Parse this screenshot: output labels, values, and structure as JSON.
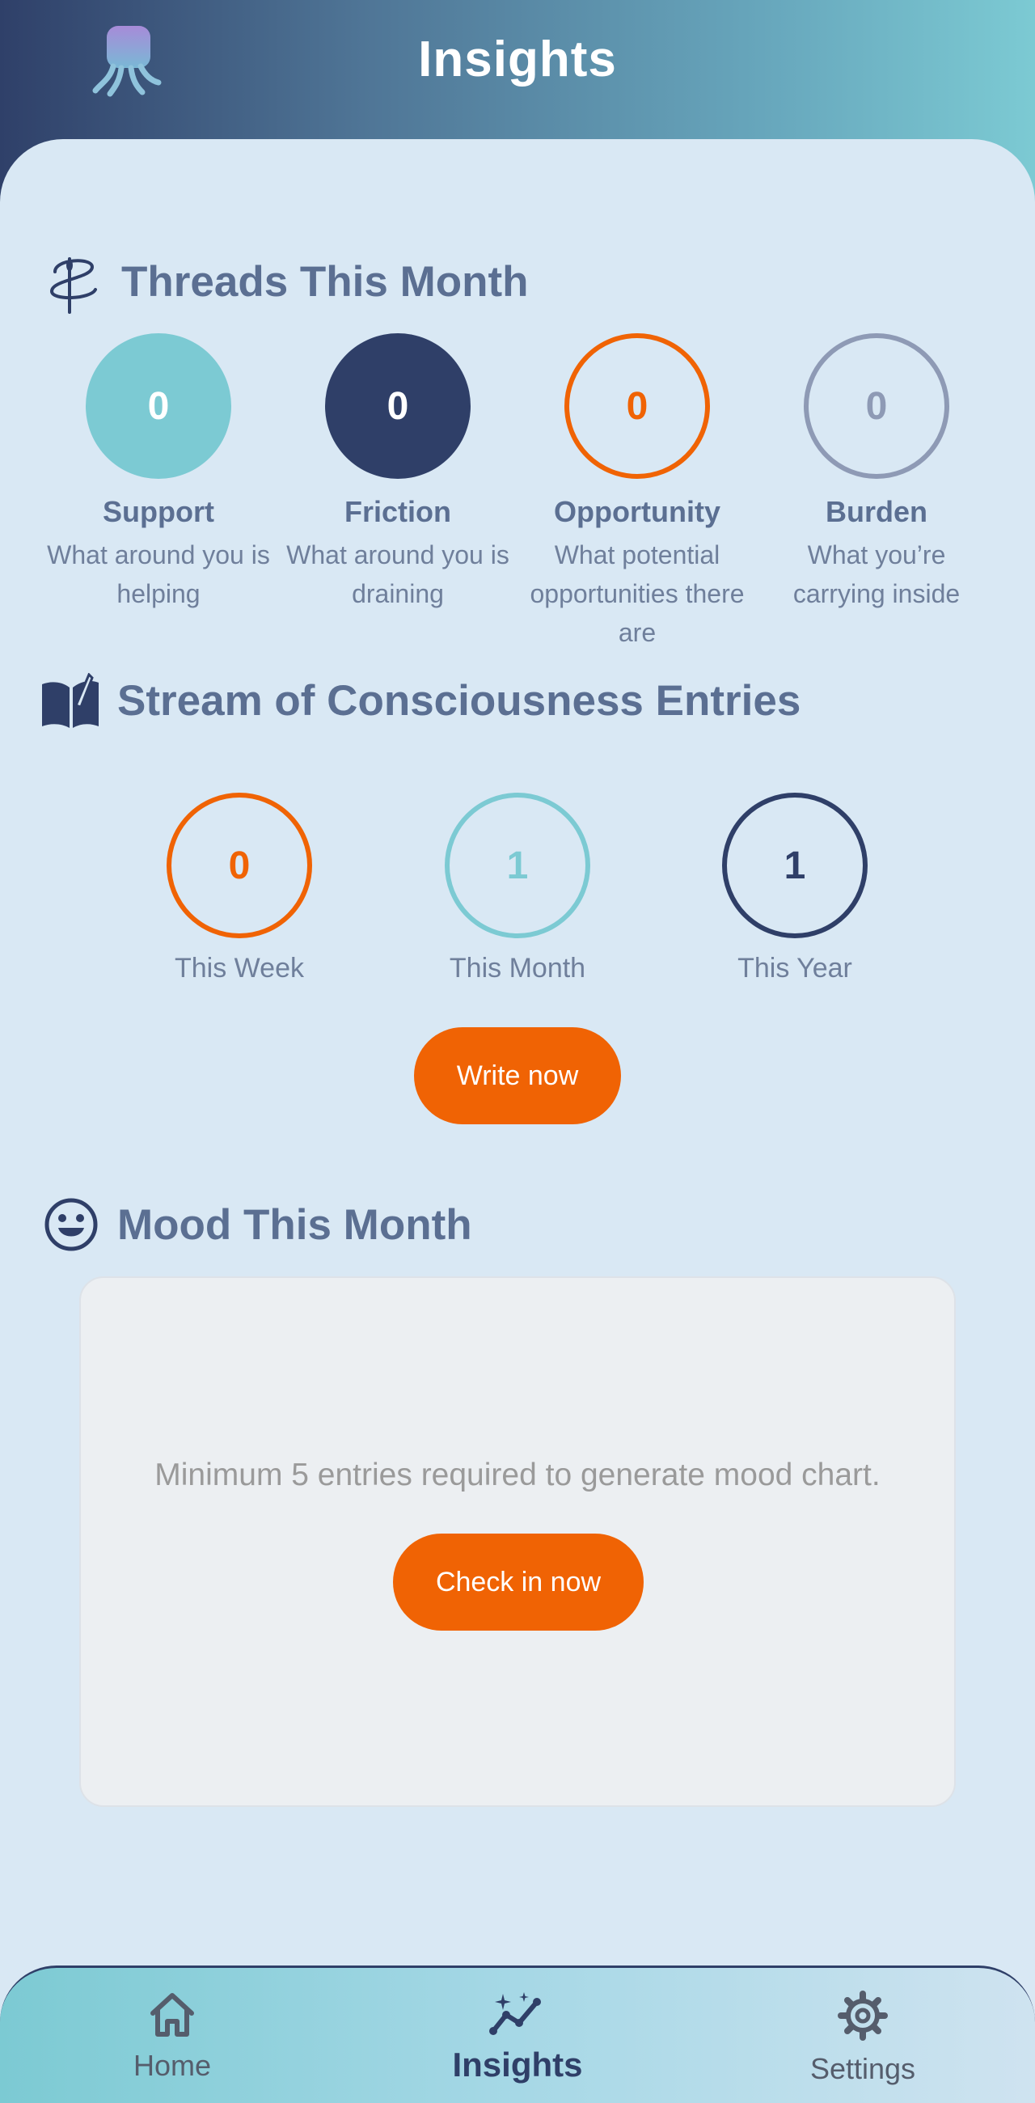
{
  "header": {
    "title": "Insights"
  },
  "threads": {
    "title": "Threads This Month",
    "items": [
      {
        "label": "Support",
        "count": "0",
        "description": "What around you is helping"
      },
      {
        "label": "Friction",
        "count": "0",
        "description": "What around you is draining"
      },
      {
        "label": "Opportunity",
        "count": "0",
        "description": "What potential opportunities there are"
      },
      {
        "label": "Burden",
        "count": "0",
        "description": "What you’re carrying inside"
      }
    ]
  },
  "stream": {
    "title": "Stream of Consciousness Entries",
    "stats": [
      {
        "label": "This Week",
        "count": "0"
      },
      {
        "label": "This Month",
        "count": "1"
      },
      {
        "label": "This Year",
        "count": "1"
      }
    ],
    "write_button": "Write now"
  },
  "mood": {
    "title": "Mood This Month",
    "message": "Minimum 5 entries required to generate mood chart.",
    "checkin_button": "Check in now"
  },
  "nav": {
    "items": [
      {
        "label": "Home",
        "icon": "home-icon"
      },
      {
        "label": "Insights",
        "icon": "insights-icon",
        "active": true
      },
      {
        "label": "Settings",
        "icon": "gear-icon"
      }
    ]
  },
  "colors": {
    "navy": "#2f3f68",
    "teal": "#7ccad3",
    "orange": "#f06304",
    "gray": "#8e9ab5",
    "background": "#d9e8f4"
  }
}
